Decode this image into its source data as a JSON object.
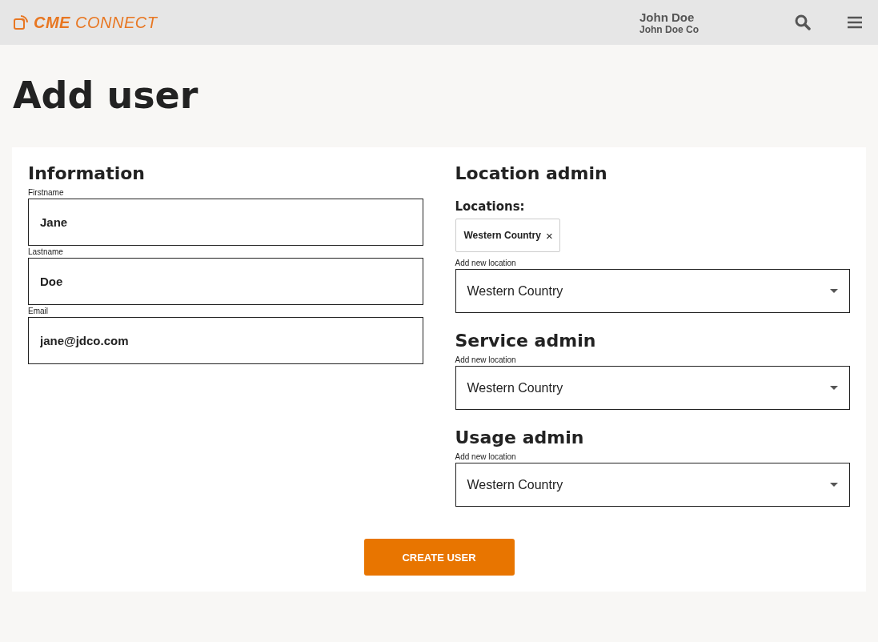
{
  "header": {
    "logo": {
      "bold": "CME",
      "light": "CONNECT"
    },
    "user_name": "John Doe",
    "company": "John Doe Co"
  },
  "page_title": "Add user",
  "information": {
    "title": "Information",
    "fields": [
      {
        "label": "Firstname",
        "value": "Jane"
      },
      {
        "label": "Lastname",
        "value": "Doe"
      },
      {
        "label": "Email",
        "value": "jane@jdco.com"
      }
    ]
  },
  "admin_sections": [
    {
      "title": "Location admin",
      "locations_label": "Locations:",
      "locations": [
        {
          "label": "Western Country",
          "remove": "×"
        }
      ],
      "select_label": "Add new location",
      "select_value": "Western Country"
    },
    {
      "title": "Service admin",
      "select_label": "Add new location",
      "select_value": "Western Country"
    },
    {
      "title": "Usage admin",
      "select_label": "Add new location",
      "select_value": "Western Country"
    }
  ],
  "submit_button": "CREATE USER"
}
